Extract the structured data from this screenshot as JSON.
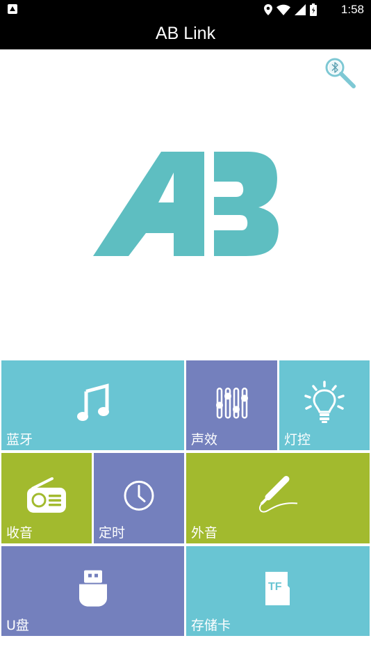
{
  "status_bar": {
    "time": "1:58",
    "icons": [
      "app-notification-icon",
      "location-icon",
      "wifi-icon",
      "signal-icon",
      "battery-icon"
    ]
  },
  "title_bar": {
    "title": "AB Link"
  },
  "header": {
    "bluetooth_search_icon": "bluetooth-search-icon"
  },
  "logo": {
    "text": "AB",
    "color": "#5ebec1"
  },
  "colors": {
    "teal": "#69c5d3",
    "purple": "#7480bd",
    "olive": "#a2ba2e"
  },
  "tiles": [
    {
      "id": "bluetooth",
      "label": "蓝牙",
      "icon": "music-note-icon",
      "color": "#69c5d3"
    },
    {
      "id": "sound-effects",
      "label": "声效",
      "icon": "equalizer-icon",
      "color": "#7480bd"
    },
    {
      "id": "light-control",
      "label": "灯控",
      "icon": "light-bulb-icon",
      "color": "#69c5d3"
    },
    {
      "id": "radio",
      "label": "收音",
      "icon": "radio-icon",
      "color": "#a2ba2e"
    },
    {
      "id": "timer",
      "label": "定时",
      "icon": "clock-icon",
      "color": "#7480bd"
    },
    {
      "id": "aux-in",
      "label": "外音",
      "icon": "audio-jack-icon",
      "color": "#a2ba2e"
    },
    {
      "id": "usb-disk",
      "label": "U盘",
      "icon": "usb-drive-icon",
      "color": "#7480bd"
    },
    {
      "id": "tf-card",
      "label": "存储卡",
      "icon": "tf-card-icon",
      "color": "#69c5d3"
    }
  ]
}
